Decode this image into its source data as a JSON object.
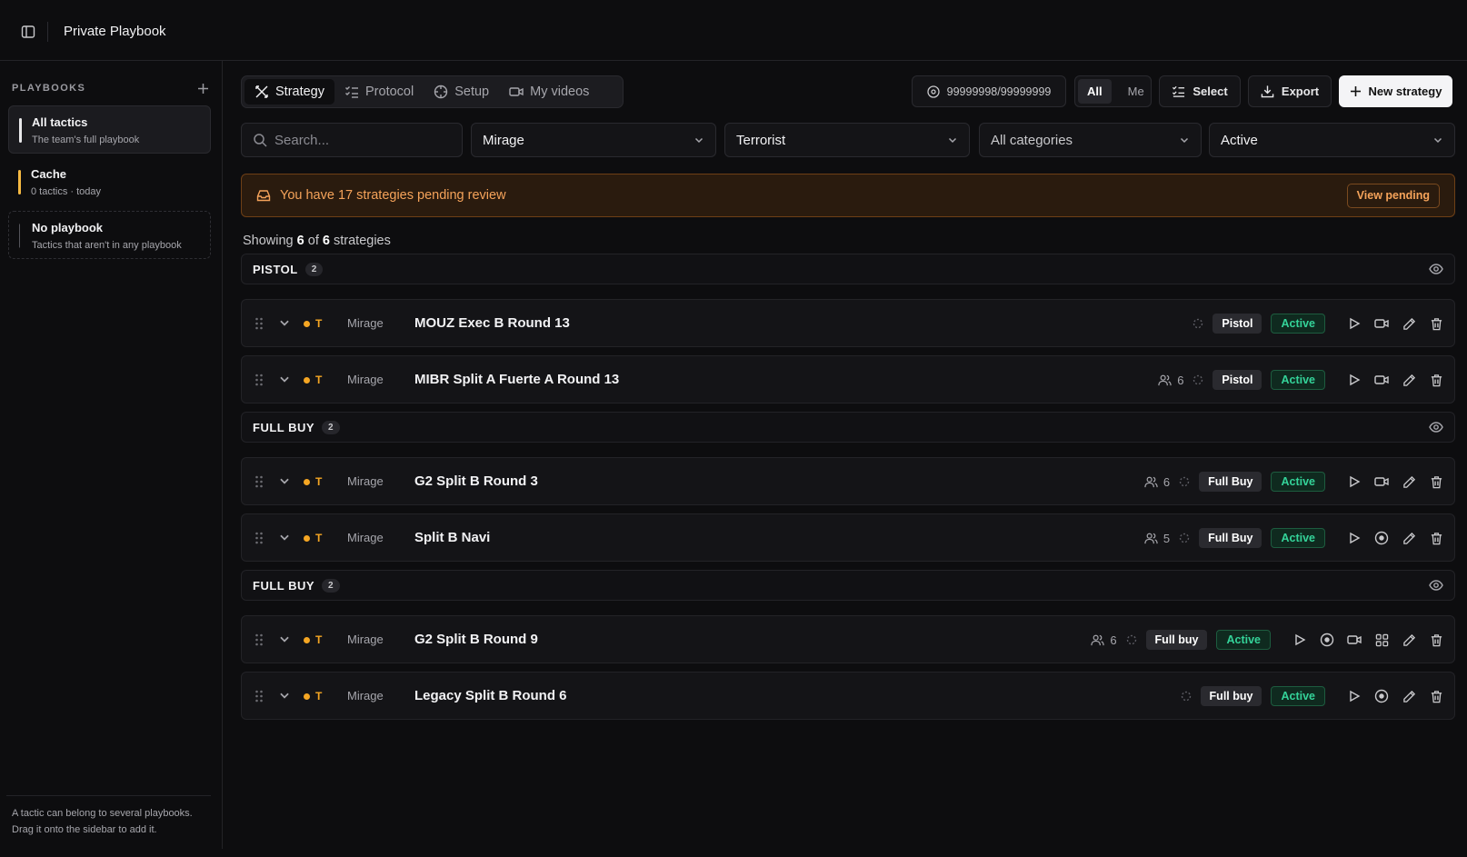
{
  "app": {
    "title": "Private Playbook"
  },
  "sidebar": {
    "header": "PLAYBOOKS",
    "playbooks": [
      {
        "title": "All tactics",
        "subtitle": "The team's full playbook",
        "color": "#e8e8ea"
      },
      {
        "title": "Cache",
        "subtitle": "0 tactics · today",
        "color": "#f5b942"
      },
      {
        "title": "No playbook",
        "subtitle": "Tactics that aren't in any playbook",
        "color": "#55555b"
      }
    ],
    "footer_line1": "A tactic can belong to several playbooks.",
    "footer_line2": "Drag it onto the sidebar to add it."
  },
  "tabs": [
    {
      "label": "Strategy",
      "icon": "strategy-icon",
      "active": true
    },
    {
      "label": "Protocol",
      "icon": "checklist-icon"
    },
    {
      "label": "Setup",
      "icon": "crosshair-icon"
    },
    {
      "label": "My videos",
      "icon": "video-icon"
    }
  ],
  "toolbar": {
    "credits": "99999998/99999999",
    "seg_all": "All",
    "seg_me": "Me",
    "select_label": "Select",
    "export_label": "Export",
    "new_label": "New strategy"
  },
  "filters": {
    "search_placeholder": "Search...",
    "map": "Mirage",
    "side": "Terrorist",
    "category": "All categories",
    "status": "Active"
  },
  "banner": {
    "text": "You have 17 strategies pending review",
    "button": "View pending"
  },
  "summary": {
    "prefix": "Showing",
    "shown": "6",
    "of": "of",
    "total": "6",
    "suffix": "strategies"
  },
  "groups": [
    {
      "title": "PISTOL",
      "count": "2"
    },
    {
      "title": "FULL BUY",
      "count": "2"
    },
    {
      "title": "FULL BUY",
      "count": "2"
    }
  ],
  "strategies": [
    {
      "side": "T",
      "map": "Mirage",
      "title": "MOUZ Exec B Round 13",
      "players": "",
      "category": "Pistol",
      "status": "Active"
    },
    {
      "side": "T",
      "map": "Mirage",
      "title": "MIBR Split A Fuerte A Round 13",
      "players": "6",
      "category": "Pistol",
      "status": "Active"
    },
    {
      "side": "T",
      "map": "Mirage",
      "title": "G2 Split B Round 3",
      "players": "6",
      "category": "Full Buy",
      "status": "Active"
    },
    {
      "side": "T",
      "map": "Mirage",
      "title": "Split B Navi",
      "players": "5",
      "category": "Full Buy",
      "status": "Active"
    },
    {
      "side": "T",
      "map": "Mirage",
      "title": "G2 Split B Round 9",
      "players": "6",
      "category": "Full buy",
      "status": "Active"
    },
    {
      "side": "T",
      "map": "Mirage",
      "title": "Legacy Split B Round 6",
      "players": "",
      "category": "Full buy",
      "status": "Active"
    }
  ]
}
